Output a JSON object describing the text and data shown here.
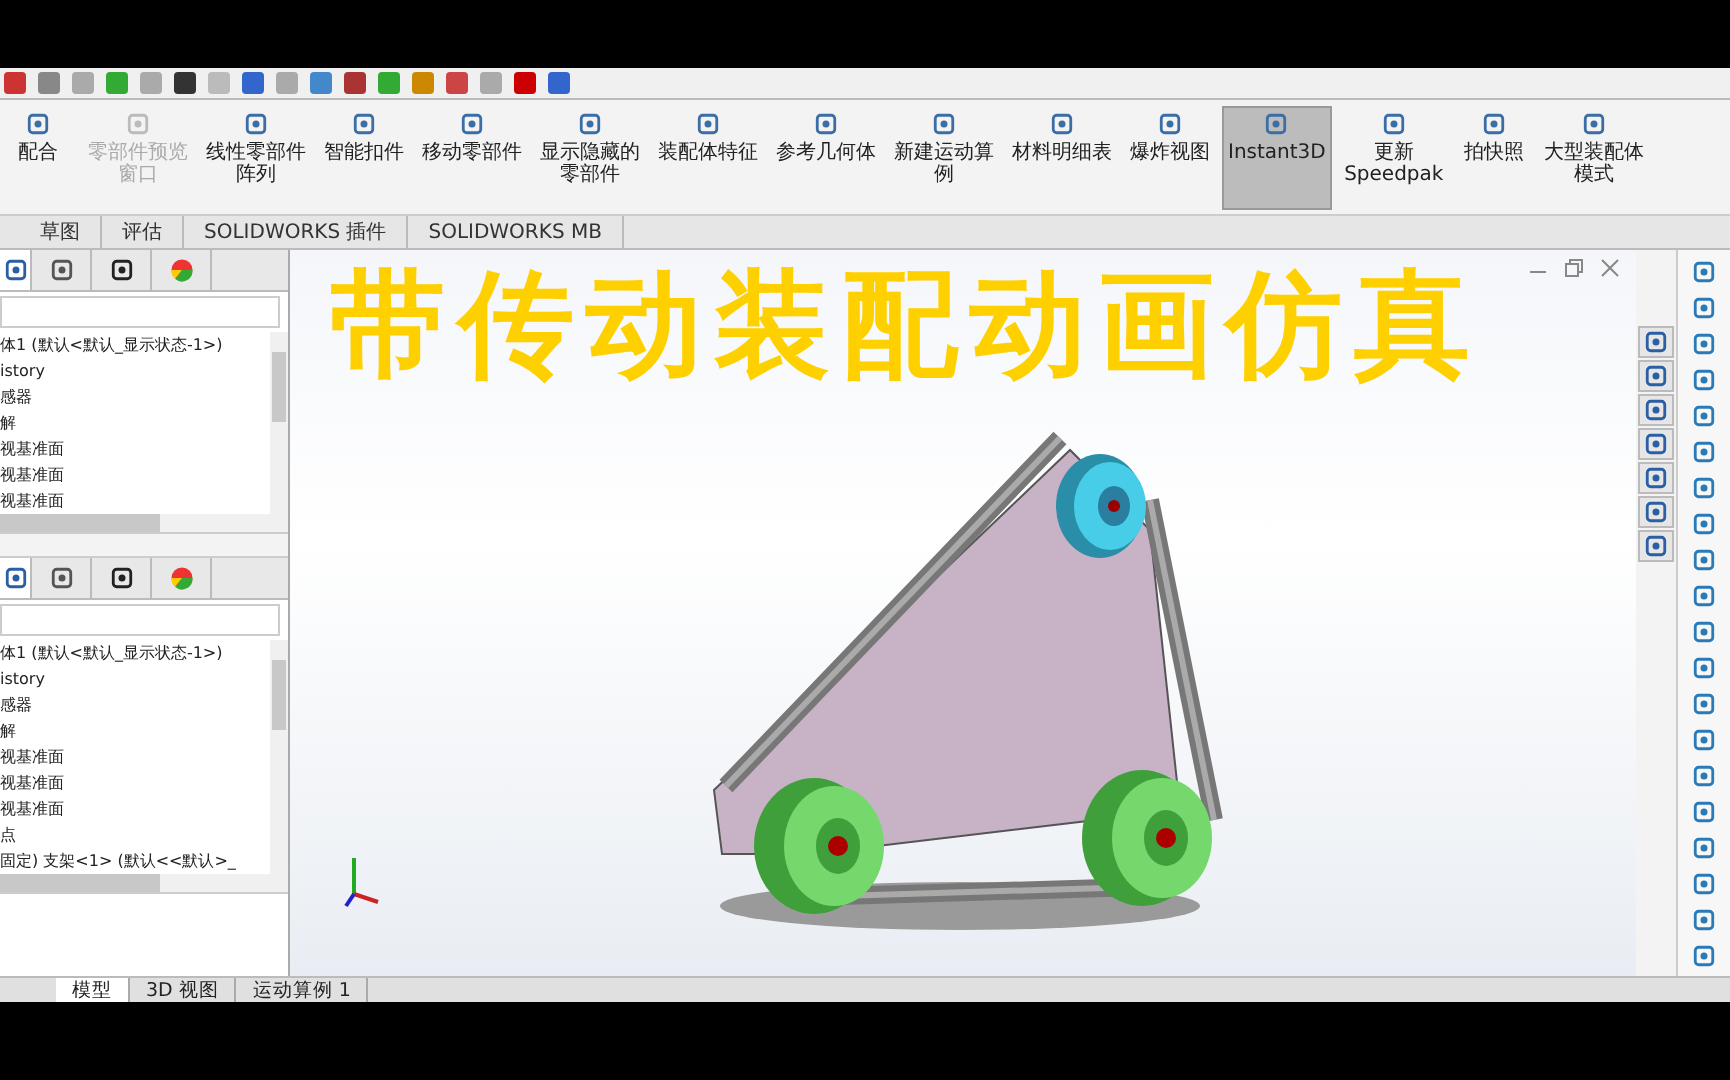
{
  "title_overlay": "带传动装配动画仿真",
  "ribbon": [
    {
      "label": "配合",
      "disabled": false,
      "selected": false
    },
    {
      "label": "零部件预览窗口",
      "disabled": true,
      "selected": false
    },
    {
      "label": "线性零部件阵列",
      "disabled": false,
      "selected": false
    },
    {
      "label": "智能扣件",
      "disabled": false,
      "selected": false
    },
    {
      "label": "移动零部件",
      "disabled": false,
      "selected": false
    },
    {
      "label": "显示隐藏的零部件",
      "disabled": false,
      "selected": false
    },
    {
      "label": "装配体特征",
      "disabled": false,
      "selected": false
    },
    {
      "label": "参考几何体",
      "disabled": false,
      "selected": false
    },
    {
      "label": "新建运动算例",
      "disabled": false,
      "selected": false
    },
    {
      "label": "材料明细表",
      "disabled": false,
      "selected": false
    },
    {
      "label": "爆炸视图",
      "disabled": false,
      "selected": false
    },
    {
      "label": "Instant3D",
      "disabled": false,
      "selected": true
    },
    {
      "label": "更新Speedpak",
      "disabled": false,
      "selected": false
    },
    {
      "label": "拍快照",
      "disabled": false,
      "selected": false
    },
    {
      "label": "大型装配体模式",
      "disabled": false,
      "selected": false
    }
  ],
  "command_tabs": [
    "草图",
    "评估",
    "SOLIDWORKS 插件",
    "SOLIDWORKS MB"
  ],
  "panes": [
    {
      "items": [
        "体1 (默认<默认_显示状态-1>)",
        "istory",
        "感器",
        "解",
        "视基准面",
        "视基准面",
        "视基准面"
      ]
    },
    {
      "items": [
        "体1 (默认<默认_显示状态-1>)",
        "istory",
        "感器",
        "解",
        "视基准面",
        "视基准面",
        "视基准面",
        "点",
        "固定) 支架<1> (默认<<默认>_"
      ]
    }
  ],
  "bottom_tabs": [
    {
      "label": "模型",
      "selected": true
    },
    {
      "label": "3D 视图",
      "selected": false
    },
    {
      "label": "运动算例 1",
      "selected": false
    }
  ]
}
